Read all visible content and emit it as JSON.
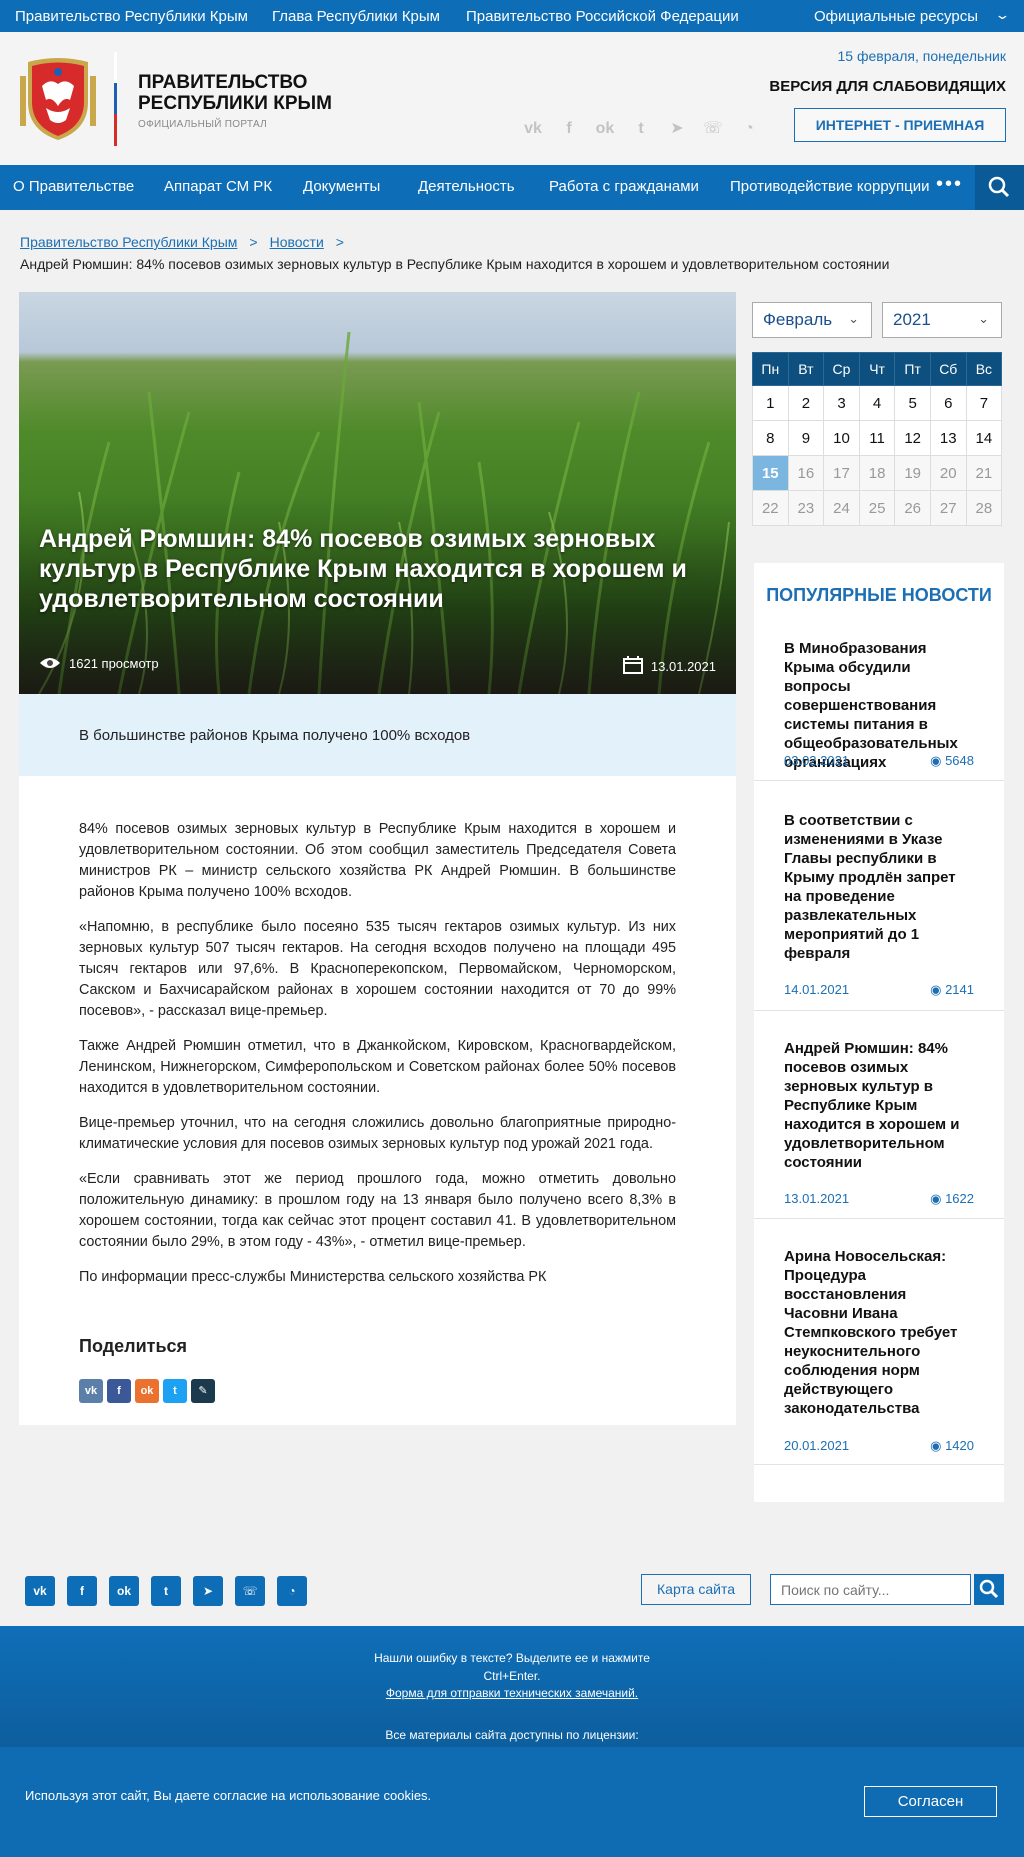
{
  "topbar": {
    "links": [
      "Правительство Республики Крым",
      "Глава Республики Крым",
      "Правительство Российской Федерации"
    ],
    "official": "Официальные ресурсы"
  },
  "header": {
    "title_line1": "ПРАВИТЕЛЬСТВО",
    "title_line2": "РЕСПУБЛИКИ КРЫМ",
    "subtitle": "ОФИЦИАЛЬНЫЙ ПОРТАЛ",
    "date": "15 февраля, понедельник",
    "vision": "ВЕРСИЯ ДЛЯ СЛАБОВИДЯЩИХ",
    "reception": "ИНТЕРНЕТ - ПРИЕМНАЯ",
    "social_icons": [
      "vk-icon",
      "facebook-icon",
      "odnoklassniki-icon",
      "twitter-icon",
      "telegram-icon",
      "viber-icon",
      "rss-icon"
    ]
  },
  "nav": {
    "items": [
      "О Правительстве",
      "Аппарат СМ РК",
      "Документы",
      "Деятельность",
      "Работа с гражданами",
      "Противодействие коррупции"
    ]
  },
  "breadcrumb": {
    "home": "Правительство Республики Крым",
    "section": "Новости",
    "sep": ">",
    "current": "Андрей Рюмшин: 84% посевов озимых зерновых культур в Республике Крым находится в хорошем и удовлетворительном состоянии"
  },
  "article": {
    "title": "Андрей Рюмшин: 84% посевов озимых зерновых культур в Республике Крым находится в хорошем и удовлетворительном состоянии",
    "views": "1621 просмотр",
    "date": "13.01.2021",
    "lead": "В большинстве районов Крыма получено 100% всходов",
    "paragraphs": [
      "84% посевов озимых зерновых культур в Республике Крым находится в хорошем и удовлетворительном состоянии. Об этом сообщил заместитель Председателя Совета министров РК – министр сельского хозяйства РК Андрей Рюмшин. В большинстве районов Крыма получено 100% всходов.",
      "«Напомню, в республике было посеяно 535 тысяч гектаров озимых культур. Из них зерновых культур 507 тысяч гектаров. На сегодня всходов получено на площади 495 тысяч гектаров или 97,6%. В Красноперекопском, Первомайском, Черноморском, Сакском и Бахчисарайском районах в хорошем состоянии находится от 70 до 99% посевов», - рассказал вице-премьер.",
      "Также Андрей Рюмшин отметил, что в Джанкойском, Кировском, Красногвардейском, Ленинском, Нижнегорском, Симферопольском и Советском районах более 50% посевов находится в удовлетворительном  состоянии.",
      "Вице-премьер уточнил, что на сегодня сложились довольно благоприятные природно-климатические условия для посевов озимых зерновых культур под урожай 2021 года.",
      "«Если сравнивать этот же период прошлого года, можно отметить довольно положительную динамику: в прошлом году на 13 января было получено всего 8,3% в хорошем состоянии, тогда как сейчас этот процент составил 41. В удовлетворительном состоянии было 29%, в этом году - 43%», - отметил вице-премьер.",
      "По информации пресс-службы Министерства сельского хозяйства РК"
    ],
    "share_title": "Поделиться",
    "share_icons": [
      "vk-icon",
      "facebook-icon",
      "odnoklassniki-icon",
      "twitter-icon",
      "livejournal-icon"
    ]
  },
  "calendar": {
    "month": "Февраль",
    "year": "2021",
    "weekdays": [
      "Пн",
      "Вт",
      "Ср",
      "Чт",
      "Пт",
      "Сб",
      "Вс"
    ],
    "weeks": [
      [
        "1",
        "2",
        "3",
        "4",
        "5",
        "6",
        "7"
      ],
      [
        "8",
        "9",
        "10",
        "11",
        "12",
        "13",
        "14"
      ],
      [
        "15",
        "16",
        "17",
        "18",
        "19",
        "20",
        "21"
      ],
      [
        "22",
        "23",
        "24",
        "25",
        "26",
        "27",
        "28"
      ]
    ],
    "today": "15"
  },
  "popular": {
    "title": "ПОПУЛЯРНЫЕ НОВОСТИ",
    "items": [
      {
        "title": "В Минобразования Крыма обсудили вопросы совершенствования системы питания в общеобразовательных организациях",
        "date": "03.02.2021",
        "views": "5648"
      },
      {
        "title": "В соответствии с изменениями в Указе Главы республики в Крыму продлён запрет на проведение развлекательных мероприятий до 1 февраля",
        "date": "14.01.2021",
        "views": "2141"
      },
      {
        "title": "Андрей Рюмшин: 84% посевов озимых зерновых культур в Республике Крым находится в хорошем и удовлетворительном состоянии",
        "date": "13.01.2021",
        "views": "1622"
      },
      {
        "title": "Арина Новосельская: Процедура восстановления Часовни Ивана Стемпковского требует неукоснительного соблюдения норм действующего законодательства",
        "date": "20.01.2021",
        "views": "1420"
      }
    ]
  },
  "footer": {
    "sitemap": "Карта сайта",
    "search_placeholder": "Поиск по сайту...",
    "error_line1": "Нашли ошибку в тексте? Выделите ее и нажмите",
    "error_line2": "Ctrl+Enter.",
    "error_link": "Форма для отправки технических замечаний.",
    "license": "Все материалы сайта доступны по лицензии:",
    "social_icons": [
      "vk-icon",
      "facebook-icon",
      "odnoklassniki-icon",
      "twitter-icon",
      "telegram-icon",
      "viber-icon",
      "rss-icon"
    ]
  },
  "cookie": {
    "text": "Используя этот сайт, Вы даете согласие на использование cookies.",
    "button": "Согласен"
  },
  "colors": {
    "primary": "#0d6db6",
    "dark_nav": "#0d4f7e",
    "lead_bg": "#e3f1fb",
    "today": "#7bb6e0"
  }
}
